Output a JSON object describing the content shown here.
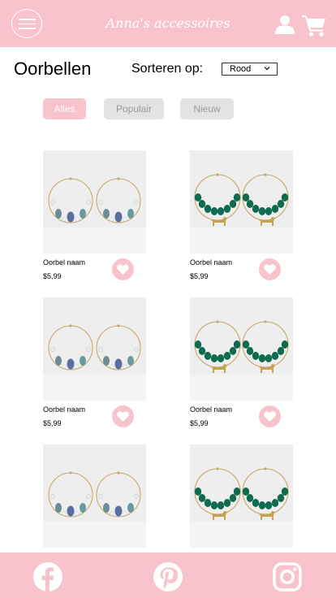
{
  "header": {
    "brand": "Anna's accessoires",
    "icons": [
      "menu-icon",
      "user-icon",
      "cart-icon"
    ]
  },
  "page": {
    "title": "Oorbellen",
    "sort_label": "Sorteren op:",
    "sort_value": "Rood"
  },
  "filters": [
    {
      "label": "Alles",
      "active": true
    },
    {
      "label": "Populair",
      "active": false
    },
    {
      "label": "Nieuw",
      "active": false
    }
  ],
  "products": [
    {
      "name": "Oorbel naam",
      "price": "$5,99",
      "variant": "crystal"
    },
    {
      "name": "Oorbel naam",
      "price": "$5,99",
      "variant": "green"
    },
    {
      "name": "Oorbel naam",
      "price": "$5,99",
      "variant": "crystal"
    },
    {
      "name": "Oorbel naam",
      "price": "$5,99",
      "variant": "green"
    },
    {
      "name": "",
      "price": "",
      "variant": "crystal"
    },
    {
      "name": "",
      "price": "",
      "variant": "green"
    }
  ],
  "footer": {
    "icons": [
      "facebook-icon",
      "pinterest-icon",
      "instagram-icon"
    ]
  },
  "colors": {
    "accent": "#f9c3cd",
    "pill_inactive": "#e3e3e3",
    "white": "#ffffff"
  }
}
